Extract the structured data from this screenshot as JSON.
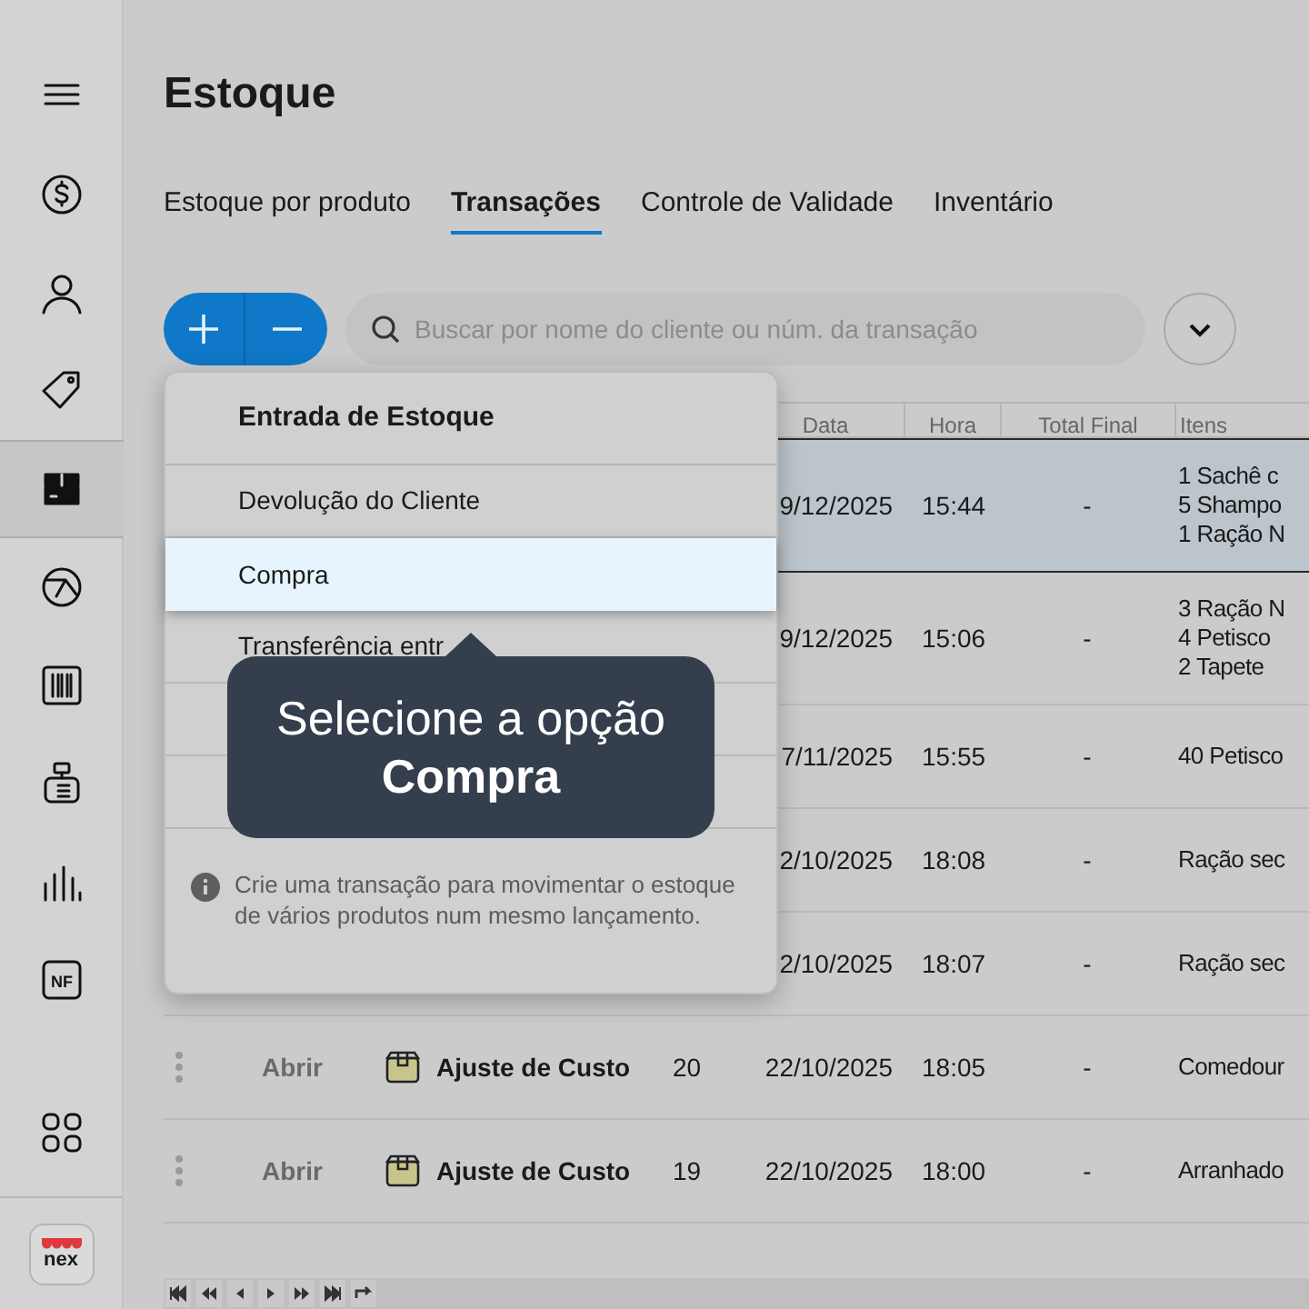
{
  "sidebar": {
    "items": [
      {
        "kind": "menu",
        "selected": false
      },
      {
        "kind": "money",
        "selected": false
      },
      {
        "kind": "user",
        "selected": false
      },
      {
        "kind": "tag",
        "selected": false
      },
      {
        "kind": "box",
        "selected": true
      },
      {
        "kind": "chart",
        "selected": false
      },
      {
        "kind": "barcode",
        "selected": false
      },
      {
        "kind": "register",
        "selected": false
      },
      {
        "kind": "bars",
        "selected": false
      },
      {
        "kind": "invoice",
        "label": "NF",
        "selected": false
      },
      {
        "kind": "apps",
        "selected": false
      }
    ],
    "logo": {
      "text": "nex"
    }
  },
  "title": "Estoque",
  "tabs": [
    {
      "label": "Estoque por produto",
      "selected": false
    },
    {
      "label": "Transações",
      "selected": true
    },
    {
      "label": "Controle de Validade",
      "selected": false
    },
    {
      "label": "Inventário",
      "selected": false
    }
  ],
  "search": {
    "placeholder": "Buscar por nome do cliente ou núm. da transação"
  },
  "table": {
    "columns": [
      "Data",
      "Hora",
      "Total Final",
      "Itens"
    ],
    "rows": [
      {
        "selected": true,
        "date": "9/12/2025",
        "time": "15:44",
        "total": "-",
        "items": [
          {
            "qty": "1",
            "name": "Sachê c"
          },
          {
            "qty": "5",
            "name": "Shampo"
          },
          {
            "qty": "1",
            "name": "Ração N"
          }
        ]
      },
      {
        "selected": false,
        "date": "9/12/2025",
        "time": "15:06",
        "total": "-",
        "items": [
          {
            "qty": "3",
            "name": "Ração N"
          },
          {
            "qty": "4",
            "name": "Petisco"
          },
          {
            "qty": "2",
            "name": "Tapete"
          }
        ]
      },
      {
        "selected": false,
        "date": "7/11/2025",
        "time": "15:55",
        "total": "-",
        "items": [
          {
            "qty": "40",
            "name": "Petisco"
          }
        ]
      },
      {
        "selected": false,
        "date": "2/10/2025",
        "time": "18:08",
        "total": "-",
        "items": [
          {
            "name": "Ração sec"
          }
        ]
      },
      {
        "selected": false,
        "date": "2/10/2025",
        "time": "18:07",
        "total": "-",
        "items": [
          {
            "name": "Ração sec"
          }
        ]
      },
      {
        "selected": false,
        "action": "Abrir",
        "type": "Ajuste de Custo",
        "number": "20",
        "date": "22/10/2025",
        "time": "18:05",
        "total": "-",
        "items": [
          {
            "name": "Comedour"
          }
        ]
      },
      {
        "selected": false,
        "action": "Abrir",
        "type": "Ajuste de Custo",
        "number": "19",
        "date": "22/10/2025",
        "time": "18:00",
        "total": "-",
        "items": [
          {
            "name": "Arranhado"
          }
        ]
      }
    ]
  },
  "menu": {
    "title": "Entrada de Estoque",
    "items": [
      {
        "label": "Devolução do Cliente",
        "selected": false
      },
      {
        "label": "Compra",
        "selected": true
      },
      {
        "label": "Transferência entr",
        "selected": false
      },
      {
        "selected": false
      },
      {
        "selected": false
      }
    ],
    "note": "Crie uma transação para movimentar o estoque de vários produtos num mesmo lançamento."
  },
  "tooltip": {
    "text": "Selecione a opção **Compra**"
  }
}
